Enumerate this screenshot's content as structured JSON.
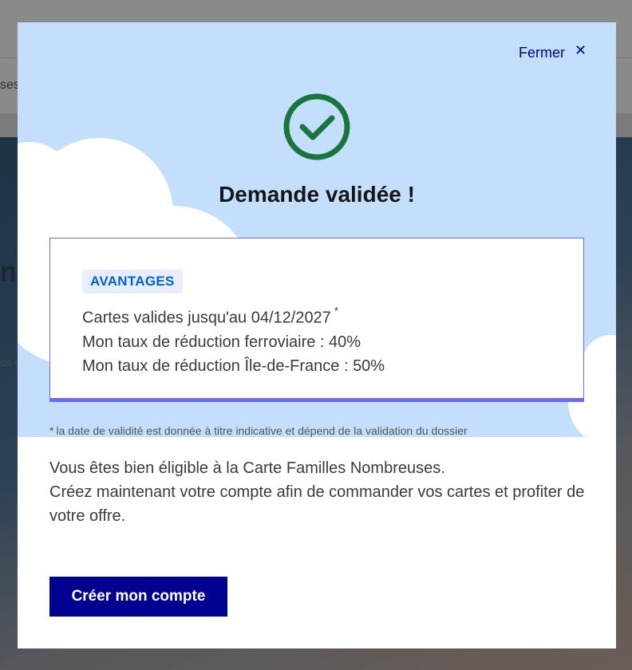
{
  "background_page": {
    "fragment_1": "ses",
    "fragment_2": "ni",
    "fragment_3": "os c"
  },
  "modal": {
    "close_label": "Fermer",
    "close_icon": "close-icon",
    "success_icon": "check-circle-icon",
    "title": "Demande validée !",
    "benefits": {
      "badge": "AVANTAGES",
      "validity_text": "Cartes valides jusqu'au 04/12/2027",
      "validity_asterisk": "*",
      "rail_discount": "Mon taux de réduction ferroviaire : 40%",
      "idf_discount": "Mon taux de réduction Île-de-France : 50%"
    },
    "footnote": {
      "asterisk": "*",
      "text": "la date de validité est donnée à titre indicative et dépend de la validation du dossier"
    },
    "body": {
      "eligibility": "Vous êtes bien éligible à la Carte Familles Nombreuses.",
      "instruction": "Créez maintenant votre compte afin de commander vos cartes et profiter de votre offre."
    },
    "cta_label": "Créer mon compte"
  },
  "colors": {
    "primary_blue": "#000091",
    "success_green": "#18753c",
    "sky_blue": "#c3dffc",
    "card_border": "#6a6af4",
    "badge_text": "#0063cb",
    "badge_bg": "#e8edff"
  }
}
